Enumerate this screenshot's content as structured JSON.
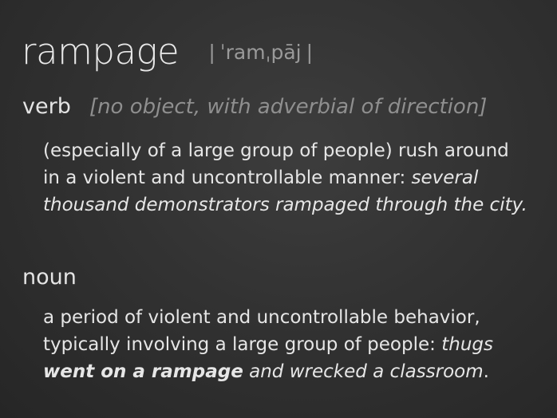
{
  "entry": {
    "headword": "rampage",
    "pronunciation": "ˈramˌpāj"
  },
  "senses": [
    {
      "pos": "verb",
      "grammar": "[no object, with adverbial of direction]",
      "definition_lines": [
        "(especially of a large group of people) rush around",
        "in a violent and uncontrollable manner: "
      ],
      "example_part1": "several",
      "example_line2": "thousand demonstrators rampaged through the city."
    },
    {
      "pos": "noun",
      "definition_lines": [
        "a period of violent and uncontrollable behavior,",
        "typically involving a large group of people: "
      ],
      "example_part1": "thugs",
      "example_bold": "went on a rampage",
      "example_rest": " and wrecked a classroom",
      "example_end": "."
    }
  ]
}
